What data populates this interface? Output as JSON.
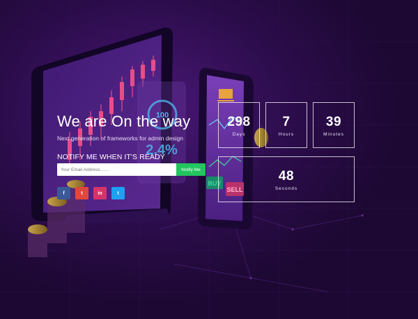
{
  "hero": {
    "title": "We are On the way",
    "subtitle": "Next generation of frameworks for admin design",
    "notify_heading": "NOTIFY ME WHEN IT'S READY"
  },
  "form": {
    "email_placeholder": "Your Email Address.......",
    "email_value": "",
    "submit_label": "Notify Me"
  },
  "social": [
    {
      "name": "facebook",
      "glyph": "f",
      "color": "#3b5998"
    },
    {
      "name": "twitter",
      "glyph": "t",
      "color": "#e0483e"
    },
    {
      "name": "linkedin",
      "glyph": "in",
      "color": "#d6336c"
    },
    {
      "name": "twitter-alt",
      "glyph": "t",
      "color": "#1da1f2"
    }
  ],
  "countdown": {
    "days": {
      "value": "298",
      "label": "Days"
    },
    "hours": {
      "value": "7",
      "label": "Hours"
    },
    "minutes": {
      "value": "39",
      "label": "Minutes"
    },
    "seconds": {
      "value": "48",
      "label": "Seconds"
    }
  },
  "illustration": {
    "coin_text": "100",
    "percent_text": "2.4%",
    "buy_label": "BUY",
    "sell_label": "SELL"
  },
  "colors": {
    "background": "#240a3d",
    "accent_green": "#22c55e",
    "accent_purple": "#7b3fc4"
  }
}
